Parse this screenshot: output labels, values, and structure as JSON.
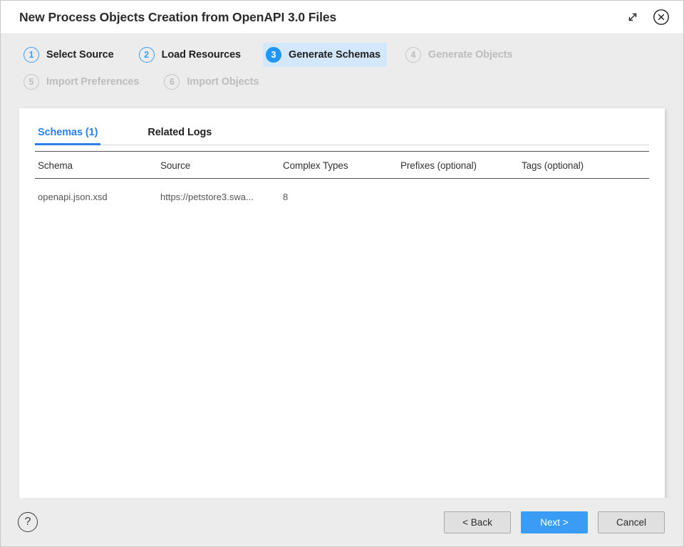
{
  "window": {
    "title": "New Process Objects Creation from OpenAPI 3.0 Files",
    "expand_icon": "expand-diagonal-icon",
    "close_icon": "close-circle-icon"
  },
  "wizard": {
    "steps": [
      {
        "number": "1",
        "label": "Select Source",
        "state": "done"
      },
      {
        "number": "2",
        "label": "Load Resources",
        "state": "done"
      },
      {
        "number": "3",
        "label": "Generate Schemas",
        "state": "active"
      },
      {
        "number": "4",
        "label": "Generate Objects",
        "state": "disabled"
      },
      {
        "number": "5",
        "label": "Import Preferences",
        "state": "disabled"
      },
      {
        "number": "6",
        "label": "Import Objects",
        "state": "disabled"
      }
    ]
  },
  "panel": {
    "tabs": [
      {
        "label": "Schemas (1)",
        "active": true
      },
      {
        "label": "Related Logs",
        "active": false
      }
    ],
    "table": {
      "headers": [
        "Schema",
        "Source",
        "Complex Types",
        "Prefixes (optional)",
        "Tags (optional)"
      ],
      "rows": [
        {
          "schema": "openapi.json.xsd",
          "source": "https://petstore3.swa...",
          "complex_types": "8",
          "prefixes": "",
          "tags": ""
        }
      ]
    }
  },
  "footer": {
    "help_icon": "help-circle-icon",
    "help_label": "?",
    "back_label": "< Back",
    "next_label": "Next >",
    "cancel_label": "Cancel"
  },
  "colors": {
    "accent_blue": "#2196f3",
    "primary_button": "#3b9cf5",
    "tab_active": "#2f7fe8",
    "active_step_bg": "#d3e8fd",
    "dialog_bg": "#ececec",
    "disabled_gray": "#bdbdbd"
  }
}
